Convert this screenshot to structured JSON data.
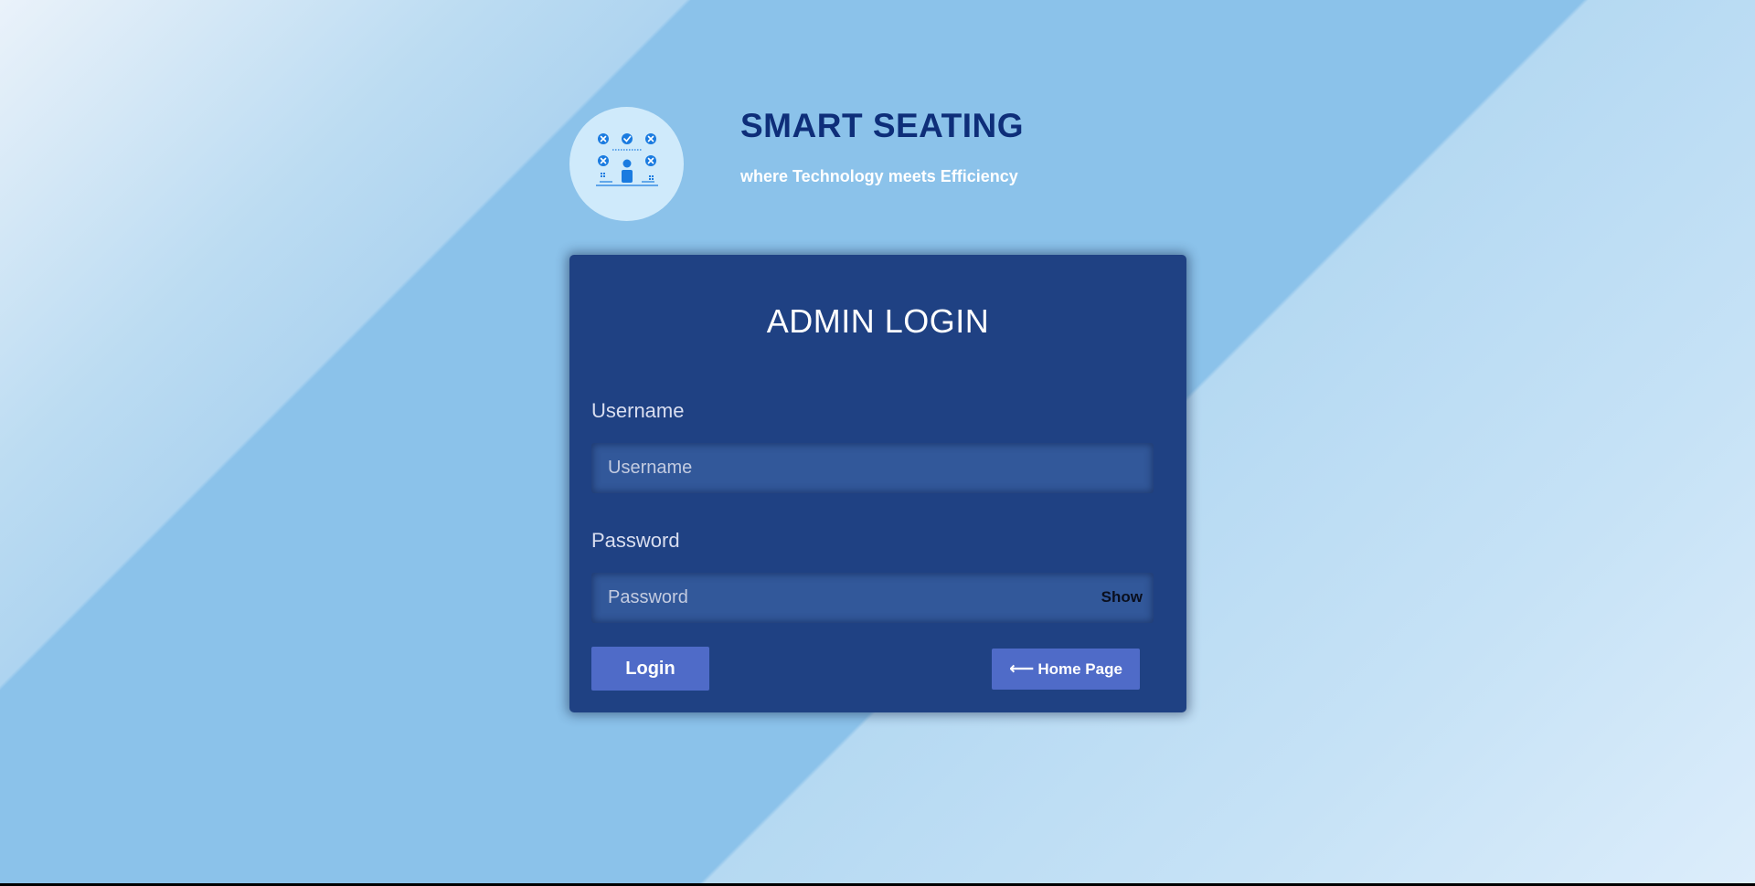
{
  "brand": {
    "title": "SMART SEATING",
    "tagline": "where Technology meets Efficiency",
    "logo_icon": "seating-arrangement-icon"
  },
  "login": {
    "title": "ADMIN LOGIN",
    "username": {
      "label": "Username",
      "placeholder": "Username",
      "value": ""
    },
    "password": {
      "label": "Password",
      "placeholder": "Password",
      "value": "",
      "toggle_label": "Show"
    },
    "login_button_label": "Login",
    "home_button_label": "Home Page",
    "home_button_icon": "arrow-left-icon"
  },
  "colors": {
    "card_background": "#1f4183",
    "button_background": "#4f6bc8",
    "brand_title": "#0e2e79",
    "logo_circle": "#cfeafb",
    "logo_icon": "#1a7be0"
  }
}
